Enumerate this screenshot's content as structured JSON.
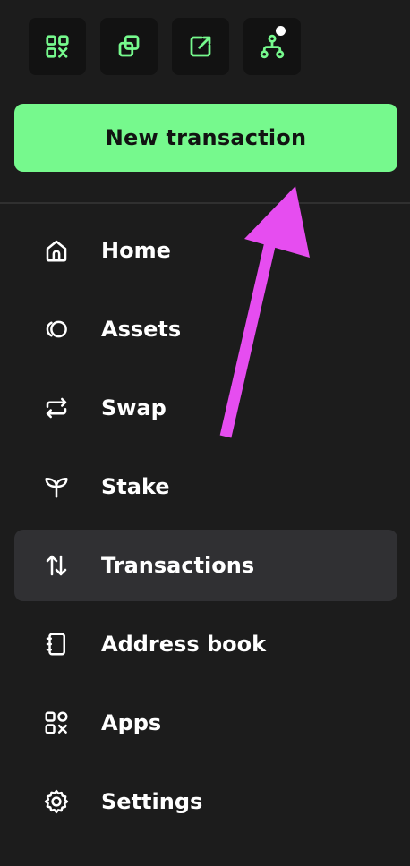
{
  "accent_color": "#76f98d",
  "annotation_color": "#e64df0",
  "top_icons": [
    {
      "icon": "qr-code-icon"
    },
    {
      "icon": "copy-icon"
    },
    {
      "icon": "external-link-icon"
    },
    {
      "icon": "network-icon",
      "has_notification": true
    }
  ],
  "new_transaction_label": "New transaction",
  "nav": {
    "items": [
      {
        "label": "Home",
        "icon": "home-icon"
      },
      {
        "label": "Assets",
        "icon": "assets-icon"
      },
      {
        "label": "Swap",
        "icon": "swap-icon"
      },
      {
        "label": "Stake",
        "icon": "stake-icon"
      },
      {
        "label": "Transactions",
        "icon": "transactions-icon",
        "active": true
      },
      {
        "label": "Address book",
        "icon": "address-book-icon"
      },
      {
        "label": "Apps",
        "icon": "apps-icon"
      },
      {
        "label": "Settings",
        "icon": "settings-icon"
      }
    ]
  }
}
